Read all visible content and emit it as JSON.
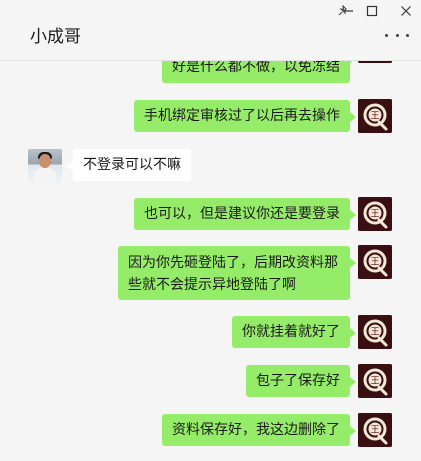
{
  "window": {
    "title": "小成哥",
    "controls": {
      "pin": "pin-icon",
      "minimize": "minimize-icon",
      "maximize": "maximize-icon"
    },
    "more_icon": "more-dots-icon"
  },
  "colors": {
    "my_bubble": "#95ec69",
    "other_bubble": "#ffffff",
    "background": "#f5f5f5"
  },
  "messages": [
    {
      "sender": "me",
      "text": "好是什么都不做，以免冻结"
    },
    {
      "sender": "me",
      "text": "手机绑定审核过了以后再去操作"
    },
    {
      "sender": "other",
      "text": "不登录可以不嘛"
    },
    {
      "sender": "me",
      "text": "也可以，但是建议你还是要登录"
    },
    {
      "sender": "me",
      "lines": [
        "因为你先砸登陆了，后期改资料那",
        "些就不会提示异地登陆了啊"
      ]
    },
    {
      "sender": "me",
      "text": "你就挂着就好了"
    },
    {
      "sender": "me",
      "text": "包子了保存好"
    },
    {
      "sender": "me",
      "text": "资料保存好，我这边删除了"
    }
  ],
  "avatar_me_glyph": "王",
  "avatar_me_letter": "Q"
}
